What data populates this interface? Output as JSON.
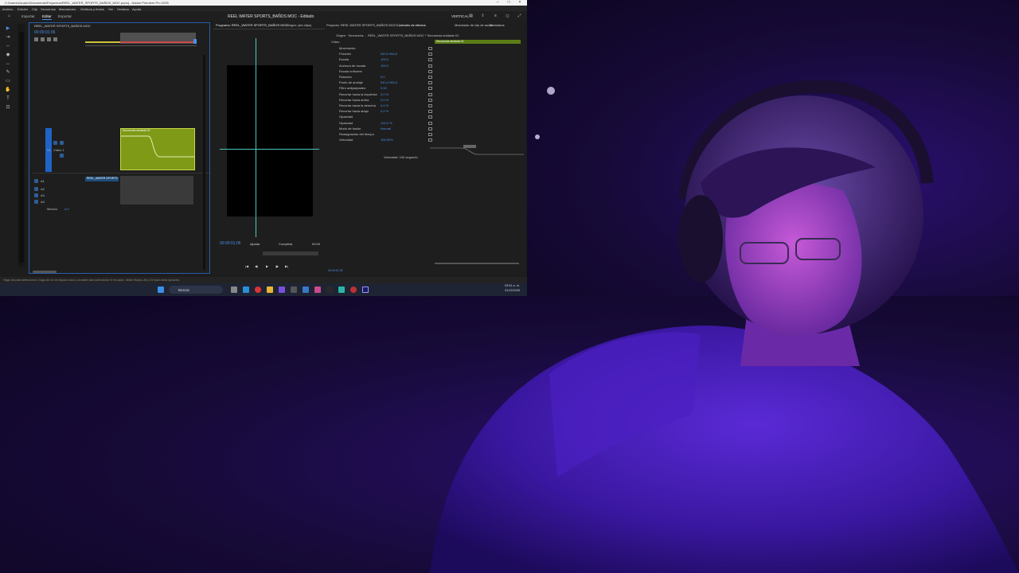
{
  "window": {
    "title": "C:\\Users\\Usuario\\Documents\\Proyectos\\REEL_WATER_SPORTS_BAÑOS_MOC.prproj - Adobe Premiere Pro 2025"
  },
  "menu": [
    "Archivo",
    "Edición",
    "Clip",
    "Secuencia",
    "Marcadores",
    "Gráficos y títulos",
    "Ver",
    "Ventana",
    "Ayuda"
  ],
  "workspaces": {
    "tabs": [
      "Importar",
      "Editar",
      "Exportar"
    ],
    "active": "Editar",
    "project_title": "REEL WATER SPORTS_BAÑOS MOC - Editado",
    "workspace_name": "VERTICAL"
  },
  "timeline": {
    "sequence_tab": "REEL_WATER SPORTS_BAÑOS MOC",
    "timecode": "00:00:01:06",
    "video_tracks": [
      {
        "label": "V1",
        "name": "Vídeo 1"
      }
    ],
    "audio_tracks": [
      {
        "label": "A1"
      },
      {
        "label": "A2"
      },
      {
        "label": "A3"
      },
      {
        "label": "A4"
      }
    ],
    "mix_label": "Mezcla",
    "mix_value": "0,0",
    "clip_video_label": "Secuencia anidada 01",
    "clip_audio_label": "REEL_WATER SPORTS"
  },
  "program": {
    "tab": "Programa: REEL_WATER SPORTS_BAÑOS MOC",
    "source_tab": "Origen: (sin clips)",
    "timecode_left": "00:00:01:06",
    "zoom": "Completa",
    "fit": "Ajustar",
    "timecode_right": "00:00"
  },
  "effects": {
    "tabs": [
      "Proyecto: REEL WATER SPORTS_BAÑOS MOC",
      "Controles de efectos",
      "Mezclador de clip de audio",
      "Metadatos"
    ],
    "active_tab": "Controles de efectos",
    "source": "Origen · Secuencia...",
    "sequence": "REEL_WATER SPORTS_BAÑOS MOC * Secuencia anidada 01",
    "clip_name": "Secuencia anidada 01",
    "section_video": "Vídeo",
    "rows": [
      {
        "name": "Movimiento",
        "value": ""
      },
      {
        "name": "Posición",
        "value": "540,0   960,0"
      },
      {
        "name": "Escala",
        "value": "100,0"
      },
      {
        "name": "Anchura de escala",
        "value": "100,0"
      },
      {
        "name": "Escala uniforme",
        "value": ""
      },
      {
        "name": "Rotación",
        "value": "0,0"
      },
      {
        "name": "Punto de anclaje",
        "value": "540,0   960,0"
      },
      {
        "name": "Filtro antiparpadeo",
        "value": "0,00"
      },
      {
        "name": "Recortar hacia la izquierda",
        "value": "0,0 %"
      },
      {
        "name": "Recortar hacia arriba",
        "value": "0,0 %"
      },
      {
        "name": "Recortar hacia la derecha",
        "value": "0,0 %"
      },
      {
        "name": "Recortar hacia abajo",
        "value": "0,0 %"
      },
      {
        "name": "Opacidad",
        "value": ""
      },
      {
        "name": "Opacidad",
        "value": "100,0 %"
      },
      {
        "name": "Modo de fusión",
        "value": "Normal"
      },
      {
        "name": "Reasignación del tiempo",
        "value": ""
      },
      {
        "name": "Velocidad",
        "value": "100,00%"
      }
    ],
    "velocity_readout": "Velocidad: 100 segundo",
    "bottom_timecode": "00:00:01:06"
  },
  "status_bar": "Haga clic para seleccionar o haga clic en un espacio vacío y arrastre para seleccionar el recuadro. Utilice Mayús, Alt y Ctrl para otras opciones.",
  "taskbar": {
    "search": "Buscar",
    "time": "03:51 a. m.",
    "date": "31/12/2025"
  }
}
